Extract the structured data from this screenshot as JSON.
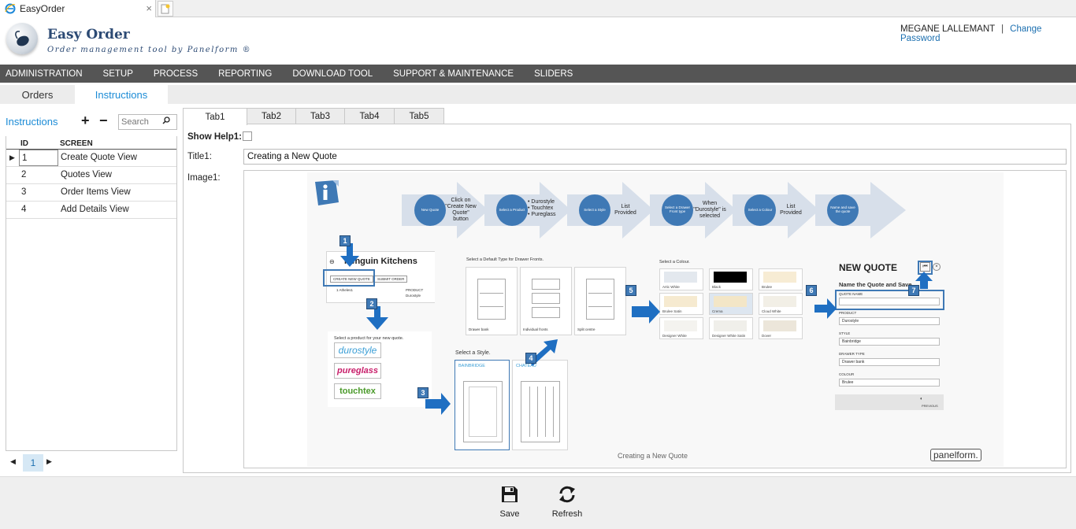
{
  "browser": {
    "tab_title": "EasyOrder",
    "close_glyph": "×"
  },
  "app": {
    "title": "Easy Order",
    "subtitle": "Order management tool by Panelform ®"
  },
  "user": {
    "name": "MEGANE LALLEMANT",
    "separator": "|",
    "change_password": "Change Password"
  },
  "nav": {
    "items": [
      "ADMINISTRATION",
      "SETUP",
      "PROCESS",
      "REPORTING",
      "DOWNLOAD TOOL",
      "SUPPORT & MAINTENANCE",
      "SLIDERS"
    ]
  },
  "subtabs": {
    "orders": "Orders",
    "instructions": "Instructions"
  },
  "left": {
    "title": "Instructions",
    "add_glyph": "+",
    "remove_glyph": "−",
    "search_placeholder": "Search",
    "columns": {
      "id": "ID",
      "screen": "SCREEN"
    },
    "rows": [
      {
        "id": "1",
        "screen": "Create Quote View"
      },
      {
        "id": "2",
        "screen": "Quotes View"
      },
      {
        "id": "3",
        "screen": "Order Items View"
      },
      {
        "id": "4",
        "screen": "Add Details View"
      }
    ],
    "pager": {
      "page": "1"
    }
  },
  "right": {
    "tabs": [
      "Tab1",
      "Tab2",
      "Tab3",
      "Tab4",
      "Tab5"
    ],
    "show_help_label": "Show Help1:",
    "title_label": "Title1:",
    "title_value": "Creating a New Quote",
    "image_label": "Image1:"
  },
  "image": {
    "steps": [
      {
        "circle": "New Quote",
        "text": "Click on \"Create New Quote\" button"
      },
      {
        "circle": "Select a Product",
        "text": "• Durostyle\n• Touchtex\n• Pureglass"
      },
      {
        "circle": "Select a Style",
        "text": "List Provided"
      },
      {
        "circle": "Select a Drawer Front type",
        "text": "When \"Durostyle\" is selected"
      },
      {
        "circle": "Select a Colour",
        "text": "List Provided"
      },
      {
        "circle": "Name and save the quote",
        "text": ""
      }
    ],
    "numbers": [
      "1",
      "2",
      "3",
      "4",
      "5",
      "6",
      "7"
    ],
    "penguin_title": "Penguin Kitchens",
    "create_btn": "CREATE NEW QUOTE",
    "submit_btn": "SUBMIT ORDER",
    "table_small": {
      "row": "1  Atheles1",
      "product_label": "PRODUCT",
      "product_value": "Durostyle"
    },
    "select_product": "Select a product for your new quote.",
    "brands": [
      "durostyle",
      "pureglass",
      "touchtex"
    ],
    "select_style": "Select a Style.",
    "styles": [
      "BAINBRIDGE",
      "CHATEAU"
    ],
    "drawer_title": "Select a Default Type for Drawer Fronts.",
    "drawers": [
      "Drawer bank",
      "Individual fronts",
      "Split centre"
    ],
    "colour_title": "Select a Colour.",
    "colours": [
      {
        "name": "Artic White",
        "hex": "#e3e8ee"
      },
      {
        "name": "Black",
        "hex": "#000000"
      },
      {
        "name": "Brulee",
        "hex": "#f7ecd4"
      },
      {
        "name": "Brulee Satin",
        "hex": "#f6ead0"
      },
      {
        "name": "Crema",
        "hex": "#f3e6c7"
      },
      {
        "name": "Cloud White",
        "hex": "#f2efe6"
      },
      {
        "name": "Designer White",
        "hex": "#f4f3ef"
      },
      {
        "name": "Designer White Satin",
        "hex": "#f0efea"
      },
      {
        "name": "Dover",
        "hex": "#ece6da"
      }
    ],
    "nq_title": "NEW QUOTE",
    "nq_sub": "Name the Quote and Save",
    "nq_fields": [
      {
        "label": "QUOTE NAME",
        "value": ""
      },
      {
        "label": "PRODUCT",
        "value": "Durostyle"
      },
      {
        "label": "STYLE",
        "value": "Bainbridge"
      },
      {
        "label": "DRAWER TYPE",
        "value": "Drawer bank"
      },
      {
        "label": "COLOUR",
        "value": "Brulee"
      }
    ],
    "previous": "PREVIOUS",
    "caption": "Creating a New Quote",
    "brand_logo": "panelform."
  },
  "footer": {
    "save": "Save",
    "refresh": "Refresh"
  },
  "colors": {
    "accent": "#1b8bd6",
    "nav_bg": "#555555",
    "step_blue": "#3f79b5"
  }
}
